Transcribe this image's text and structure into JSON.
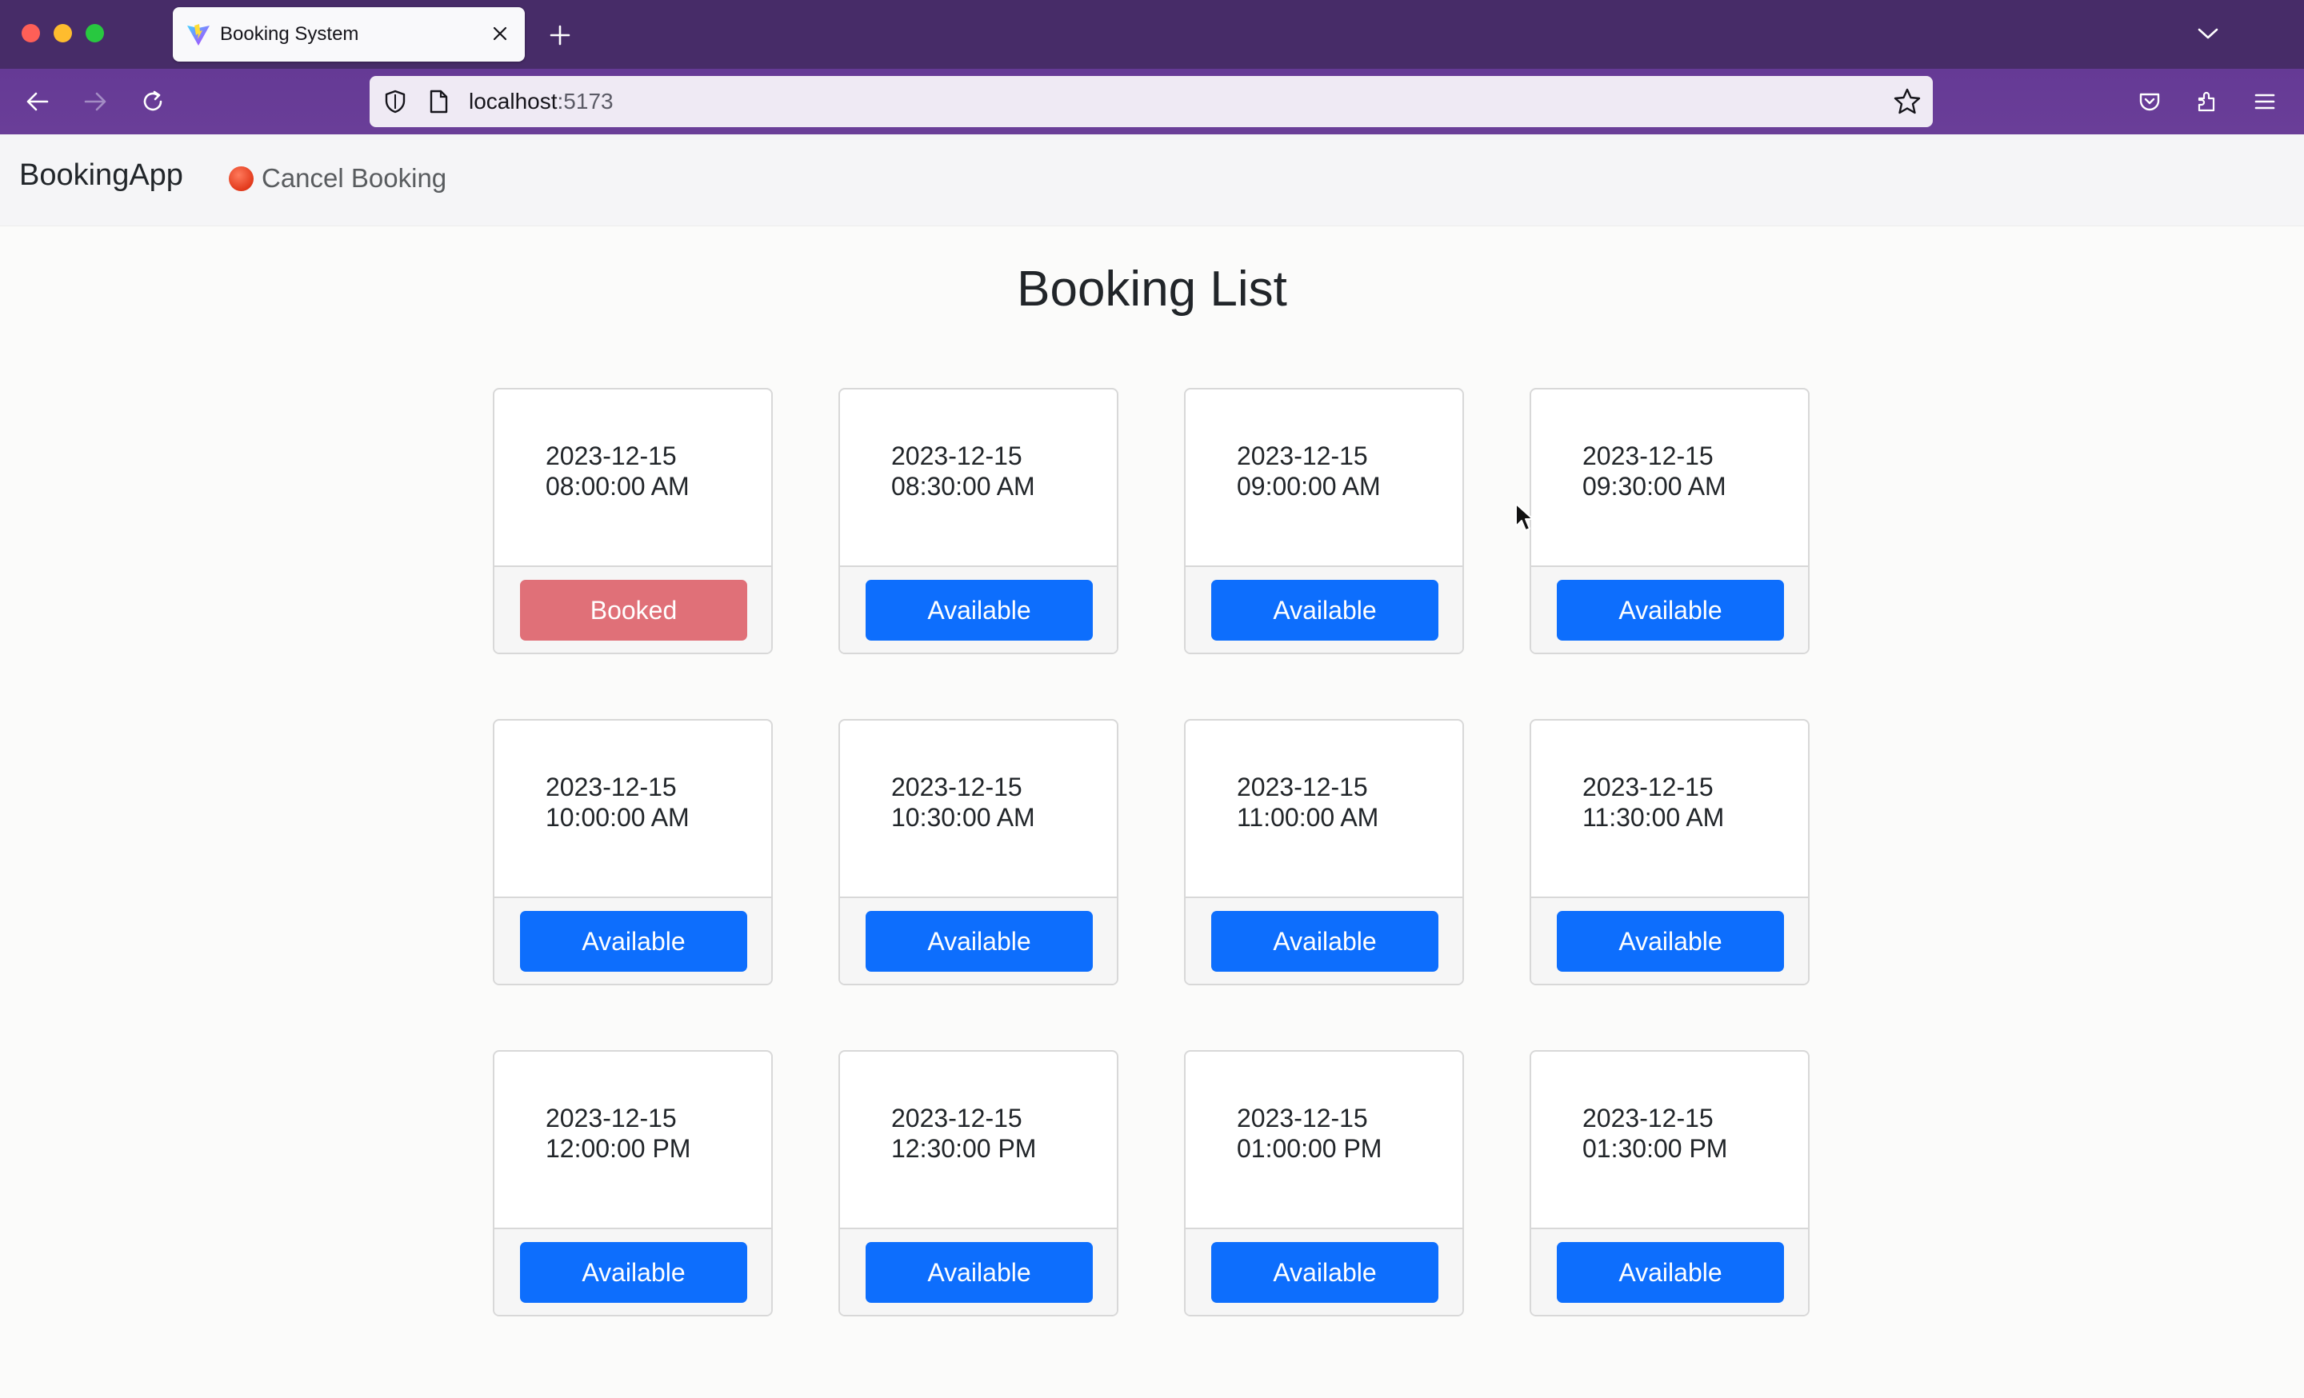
{
  "browser": {
    "tab_title": "Booking System",
    "url_host": "localhost",
    "url_port": ":5173",
    "icons": [
      "close-icon",
      "plus-icon",
      "chevron-down-icon",
      "back-arrow-icon",
      "forward-arrow-icon",
      "reload-icon",
      "shield-icon",
      "page-icon",
      "star-icon",
      "pocket-icon",
      "extensions-icon",
      "menu-icon"
    ]
  },
  "app": {
    "brand": "BookingApp",
    "nav": {
      "cancel_label": "Cancel Booking",
      "cancel_icon": "stop-sign-icon"
    },
    "title": "Booking List",
    "colors": {
      "available": "#0d6efd",
      "booked": "#e07078"
    },
    "slots": [
      {
        "date": "2023-12-15",
        "time": "08:00:00 AM",
        "status": "Booked"
      },
      {
        "date": "2023-12-15",
        "time": "08:30:00 AM",
        "status": "Available"
      },
      {
        "date": "2023-12-15",
        "time": "09:00:00 AM",
        "status": "Available"
      },
      {
        "date": "2023-12-15",
        "time": "09:30:00 AM",
        "status": "Available"
      },
      {
        "date": "2023-12-15",
        "time": "10:00:00 AM",
        "status": "Available"
      },
      {
        "date": "2023-12-15",
        "time": "10:30:00 AM",
        "status": "Available"
      },
      {
        "date": "2023-12-15",
        "time": "11:00:00 AM",
        "status": "Available"
      },
      {
        "date": "2023-12-15",
        "time": "11:30:00 AM",
        "status": "Available"
      },
      {
        "date": "2023-12-15",
        "time": "12:00:00 PM",
        "status": "Available"
      },
      {
        "date": "2023-12-15",
        "time": "12:30:00 PM",
        "status": "Available"
      },
      {
        "date": "2023-12-15",
        "time": "01:00:00 PM",
        "status": "Available"
      },
      {
        "date": "2023-12-15",
        "time": "01:30:00 PM",
        "status": "Available"
      }
    ]
  }
}
